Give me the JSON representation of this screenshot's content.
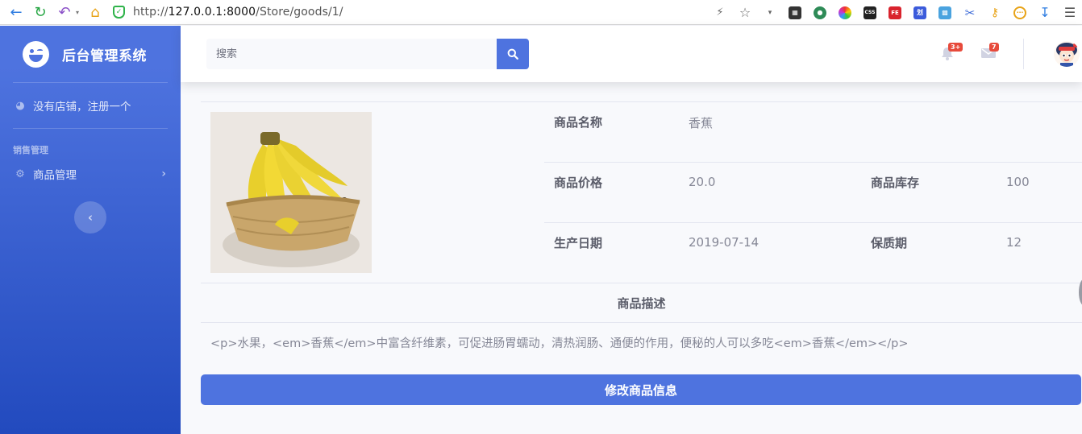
{
  "browser": {
    "url_prefix": "http://",
    "url_host": "127.0.0.1:8000",
    "url_path": "/Store/goods/1/"
  },
  "sidebar": {
    "brand": "后台管理系统",
    "shop_link": "没有店铺，注册一个",
    "section_heading": "销售管理",
    "items": [
      {
        "label": "商品管理"
      }
    ]
  },
  "topbar": {
    "search_placeholder": "搜索",
    "alerts_badge": "3+",
    "messages_badge": "7"
  },
  "product": {
    "name_label": "商品名称",
    "name": "香蕉",
    "price_label": "商品价格",
    "price": "20.0",
    "stock_label": "商品库存",
    "stock": "100",
    "date_label": "生产日期",
    "date": "2019-07-14",
    "shelf_label": "保质期",
    "shelf": "12",
    "desc_label": "商品描述",
    "desc": "<p>水果，<em>香蕉</em>中富含纤维素，可促进肠胃蠕动，清热润肠、通便的作用，便秘的人可以多吃<em>香蕉</em></p>",
    "edit_button": "修改商品信息"
  },
  "colors": {
    "primary": "#4e73df",
    "danger": "#e74a3b",
    "text_dark": "#5a5c69",
    "text_muted": "#858796"
  }
}
